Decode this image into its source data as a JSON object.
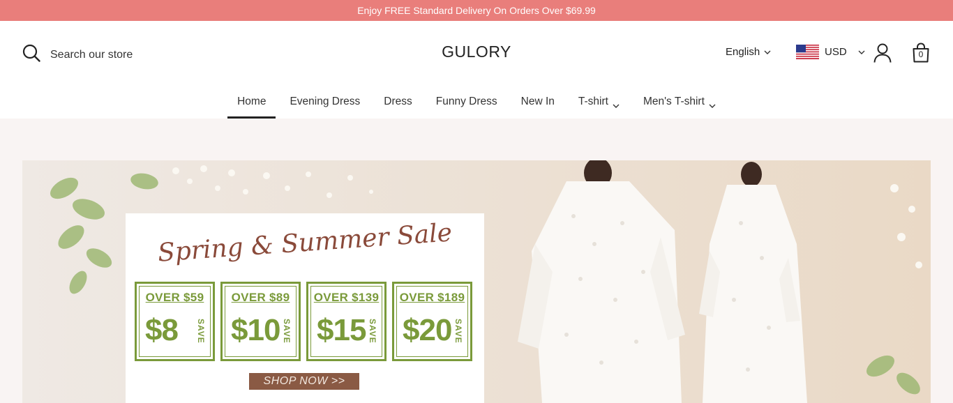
{
  "announcement": "Enjoy FREE Standard Delivery On Orders Over $69.99",
  "search": {
    "placeholder": "Search our store"
  },
  "brand": "GULORY",
  "language": "English",
  "currency": {
    "code": "USD",
    "flag_icon": "us-flag-icon"
  },
  "cart": {
    "count": "0"
  },
  "nav": [
    {
      "label": "Home",
      "active": true
    },
    {
      "label": "Evening Dress"
    },
    {
      "label": "Dress"
    },
    {
      "label": "Funny Dress"
    },
    {
      "label": "New In"
    },
    {
      "label": "T-shirt",
      "has_dropdown": true
    },
    {
      "label": "Men's T-shirt",
      "has_dropdown": true
    }
  ],
  "banner": {
    "title": "Spring & Summer Sale",
    "offers": [
      {
        "over": "OVER $59",
        "amount": "$8",
        "save": "SAVE"
      },
      {
        "over": "OVER $89",
        "amount": "$10",
        "save": "SAVE"
      },
      {
        "over": "OVER $139",
        "amount": "$15",
        "save": "SAVE"
      },
      {
        "over": "OVER $189",
        "amount": "$20",
        "save": "SAVE"
      }
    ],
    "cta": "SHOP NOW >>"
  },
  "colors": {
    "announcement_bg": "#e97e7b",
    "offer_green": "#7a9a3a",
    "title_brown": "#8a4a3a",
    "cta_bg": "#8a5a44"
  }
}
